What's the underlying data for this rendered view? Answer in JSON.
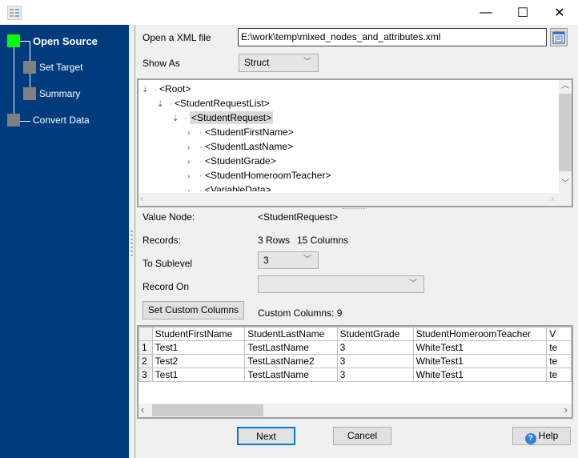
{
  "window": {
    "app_icon": "app-icon",
    "controls": {
      "minimize": "—",
      "maximize": "☐",
      "close": "✕"
    }
  },
  "sidebar": {
    "steps": [
      {
        "label": "Open Source",
        "active": true,
        "color": "#00ff00"
      },
      {
        "label": "Set Target",
        "active": false,
        "color": "#808080"
      },
      {
        "label": "Summary",
        "active": false,
        "color": "#808080"
      },
      {
        "label": "Convert Data",
        "active": false,
        "color": "#808080"
      }
    ]
  },
  "form": {
    "open_file_label": "Open a XML file",
    "file_path": "E:\\work\\temp\\mixed_nodes_and_attributes.xml",
    "browse_icon": "document-icon",
    "show_as_label": "Show As",
    "show_as_value": "Struct"
  },
  "tree": {
    "nodes": [
      {
        "label": "<Root>",
        "level": 0,
        "expanded": true
      },
      {
        "label": "<StudentRequestList>",
        "level": 1,
        "expanded": true
      },
      {
        "label": "<StudentRequest>",
        "level": 2,
        "expanded": true,
        "selected": true
      },
      {
        "label": "<StudentFirstName>",
        "level": 3,
        "expanded": false
      },
      {
        "label": "<StudentLastName>",
        "level": 3,
        "expanded": false
      },
      {
        "label": "<StudentGrade>",
        "level": 3,
        "expanded": false
      },
      {
        "label": "<StudentHomeroomTeacher>",
        "level": 3,
        "expanded": false
      },
      {
        "label": "<VariableData>",
        "level": 3,
        "expanded": false
      }
    ]
  },
  "details": {
    "value_node_label": "Value Node:",
    "value_node": "<StudentRequest>",
    "records_label": "Records:",
    "records_rows": "3 Rows",
    "records_cols": "15 Columns",
    "sublevel_label": "To Sublevel",
    "sublevel_value": "3",
    "record_on_label": "Record On",
    "record_on_value": "",
    "custom_columns_button": "Set Custom Columns",
    "custom_columns_count": "Custom Columns: 9"
  },
  "grid": {
    "columns": [
      "StudentFirstName",
      "StudentLastName",
      "StudentGrade",
      "StudentHomeroomTeacher",
      "V"
    ],
    "rows": [
      {
        "num": "1",
        "cells": [
          "Test1",
          "TestLastName",
          "3",
          "WhiteTest1",
          "te"
        ]
      },
      {
        "num": "2",
        "cells": [
          "Test2",
          "TestLastName2",
          "3",
          "WhiteTest1",
          "te"
        ]
      },
      {
        "num": "3",
        "cells": [
          "Test1",
          "TestLastName",
          "3",
          "WhiteTest1",
          "te"
        ]
      }
    ]
  },
  "footer": {
    "next": "Next",
    "cancel": "Cancel",
    "help": "Help"
  }
}
